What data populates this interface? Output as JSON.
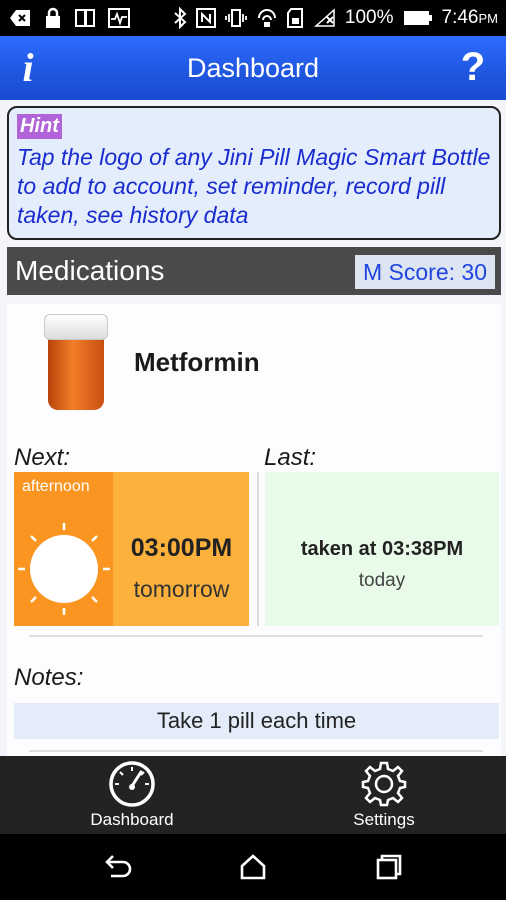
{
  "status_bar": {
    "battery": "100%",
    "time": "7:46",
    "ampm": "PM"
  },
  "app_bar": {
    "title": "Dashboard",
    "info_label": "i",
    "help_label": "?"
  },
  "hint": {
    "badge": "Hint",
    "text": "Tap the logo of any Jini Pill Magic Smart Bottle to add to account, set reminder, record pill taken, see history data"
  },
  "medications": {
    "title": "Medications",
    "score": "M Score: 30"
  },
  "med_card": {
    "name": "Metformin",
    "next_label": "Next:",
    "last_label": "Last:",
    "next": {
      "period": "afternoon",
      "time": "03:00PM",
      "day": "tomorrow"
    },
    "last": {
      "time": "taken at 03:38PM",
      "day": "today"
    },
    "notes_label": "Notes:",
    "notes": "Take 1 pill each time"
  },
  "tabs": [
    {
      "label": "Dashboard",
      "icon": "gauge-icon"
    },
    {
      "label": "Settings",
      "icon": "gear-icon"
    }
  ],
  "colors": {
    "app_bar": "#1f57e0",
    "hint_text": "#1a2bd0",
    "hint_badge": "#b064d8",
    "next_box": "#fbb13b",
    "next_left": "#fb9521",
    "last_box": "#e8fbe8",
    "score_text": "#2146e0"
  }
}
